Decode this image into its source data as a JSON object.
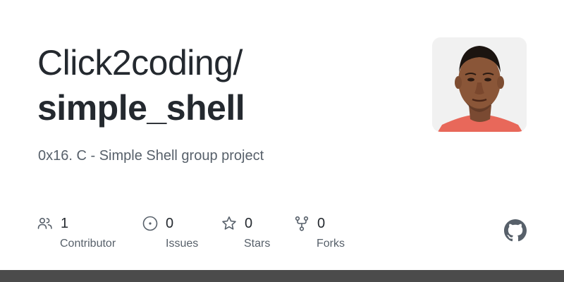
{
  "repo_card": {
    "owner": "Click2coding/",
    "name": "simple_shell",
    "description": "0x16. C - Simple Shell group project",
    "avatar_icon": "user-avatar-photo"
  },
  "stats": {
    "contributors": {
      "value": "1",
      "label": "Contributor",
      "icon": "people-icon"
    },
    "issues": {
      "value": "0",
      "label": "Issues",
      "icon": "issue-icon"
    },
    "stars": {
      "value": "0",
      "label": "Stars",
      "icon": "star-icon"
    },
    "forks": {
      "value": "0",
      "label": "Forks",
      "icon": "fork-icon"
    }
  },
  "footer": {
    "logo": "github-logo-icon",
    "bar_color": "#4b4b4b"
  },
  "colors": {
    "title": "#24292f",
    "muted": "#57606a"
  }
}
